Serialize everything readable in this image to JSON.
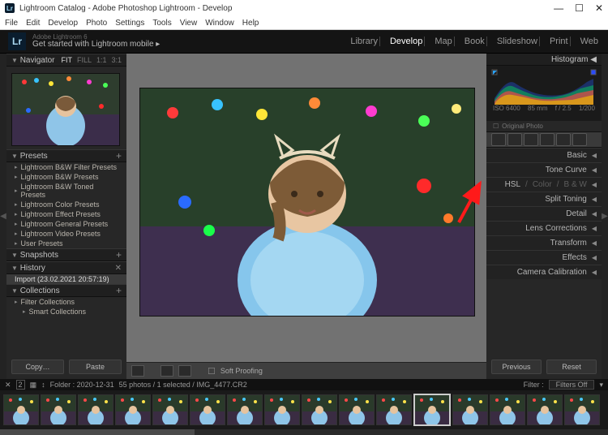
{
  "window": {
    "title": "Lightroom Catalog - Adobe Photoshop Lightroom - Develop",
    "min": "—",
    "max": "☐",
    "close": "✕"
  },
  "menubar": [
    "File",
    "Edit",
    "Develop",
    "Photo",
    "Settings",
    "Tools",
    "View",
    "Window",
    "Help"
  ],
  "brand": {
    "logo": "Lr",
    "small": "Adobe Lightroom 6",
    "big": "Get started with Lightroom mobile  ▸"
  },
  "modules": [
    "Library",
    "Develop",
    "Map",
    "Book",
    "Slideshow",
    "Print",
    "Web"
  ],
  "modules_active": "Develop",
  "left": {
    "navigator": {
      "title": "Navigator",
      "opts": [
        "FIT",
        "FILL",
        "1:1",
        "3:1"
      ]
    },
    "presets": {
      "title": "Presets",
      "items": [
        "Lightroom B&W Filter Presets",
        "Lightroom B&W Presets",
        "Lightroom B&W Toned Presets",
        "Lightroom Color Presets",
        "Lightroom Effect Presets",
        "Lightroom General Presets",
        "Lightroom Video Presets",
        "User Presets"
      ]
    },
    "snapshots": {
      "title": "Snapshots"
    },
    "history": {
      "title": "History",
      "items": [
        "Import (23.02.2021 20:57:19)"
      ]
    },
    "collections": {
      "title": "Collections",
      "items": [
        "Filter Collections",
        "Smart Collections"
      ]
    },
    "copy": "Copy…",
    "paste": "Paste"
  },
  "right": {
    "histogram": {
      "title": "Histogram",
      "iso": "ISO 6400",
      "lens": "85 mm",
      "ap": "f / 2.5",
      "sh": "1/200"
    },
    "original": "Original Photo",
    "panels": [
      {
        "label": "Basic"
      },
      {
        "label": "Tone Curve"
      },
      {
        "label": "HSL",
        "sub": "Color",
        "sub2": "B & W"
      },
      {
        "label": "Split Toning"
      },
      {
        "label": "Detail"
      },
      {
        "label": "Lens Corrections"
      },
      {
        "label": "Transform"
      },
      {
        "label": "Effects"
      },
      {
        "label": "Camera Calibration"
      }
    ],
    "previous": "Previous",
    "reset": "Reset"
  },
  "toolbar": {
    "soft": "Soft Proofing"
  },
  "status": {
    "x": "✕",
    "viewmodes": "▭▭",
    "folder": "Folder : 2020-12-31",
    "count": "55 photos / 1 selected / IMG_4477.CR2",
    "filter": "Filter :",
    "filters_off": "Filters Off"
  },
  "film_count": 16
}
